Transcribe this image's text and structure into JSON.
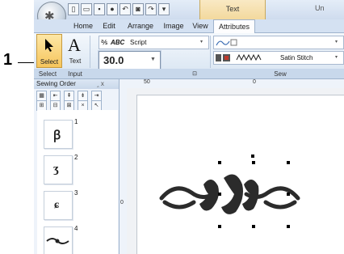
{
  "callout": {
    "number": "1"
  },
  "app": {
    "title_right": "Un",
    "context_tab": "Text",
    "orb_glyph": "✱"
  },
  "tabs": [
    {
      "label": "Home"
    },
    {
      "label": "Edit"
    },
    {
      "label": "Arrange"
    },
    {
      "label": "Image"
    },
    {
      "label": "View"
    },
    {
      "label": "Attributes",
      "active": true
    }
  ],
  "ribbon": {
    "select_label": "Select",
    "text_label": "Text",
    "text_glyph": "A",
    "font_name": "Script",
    "font_sample": "ABC",
    "text_size": "30.0",
    "stitch_type": "Satin Stitch"
  },
  "group_labels": {
    "select": "Select",
    "input": "Input",
    "sew": "Sew"
  },
  "sewing_order": {
    "title": "Sewing Order",
    "pin": "‸ x",
    "items": [
      {
        "number": "1"
      },
      {
        "number": "2"
      },
      {
        "number": "3"
      },
      {
        "number": "4"
      }
    ]
  },
  "ruler": {
    "top_left": "50",
    "top_right": "0",
    "left": "0"
  },
  "colors": {
    "accent": "#f6c55c",
    "ribbon_bg": "#dfe8f5",
    "embroidery": "#2b2b2b"
  }
}
